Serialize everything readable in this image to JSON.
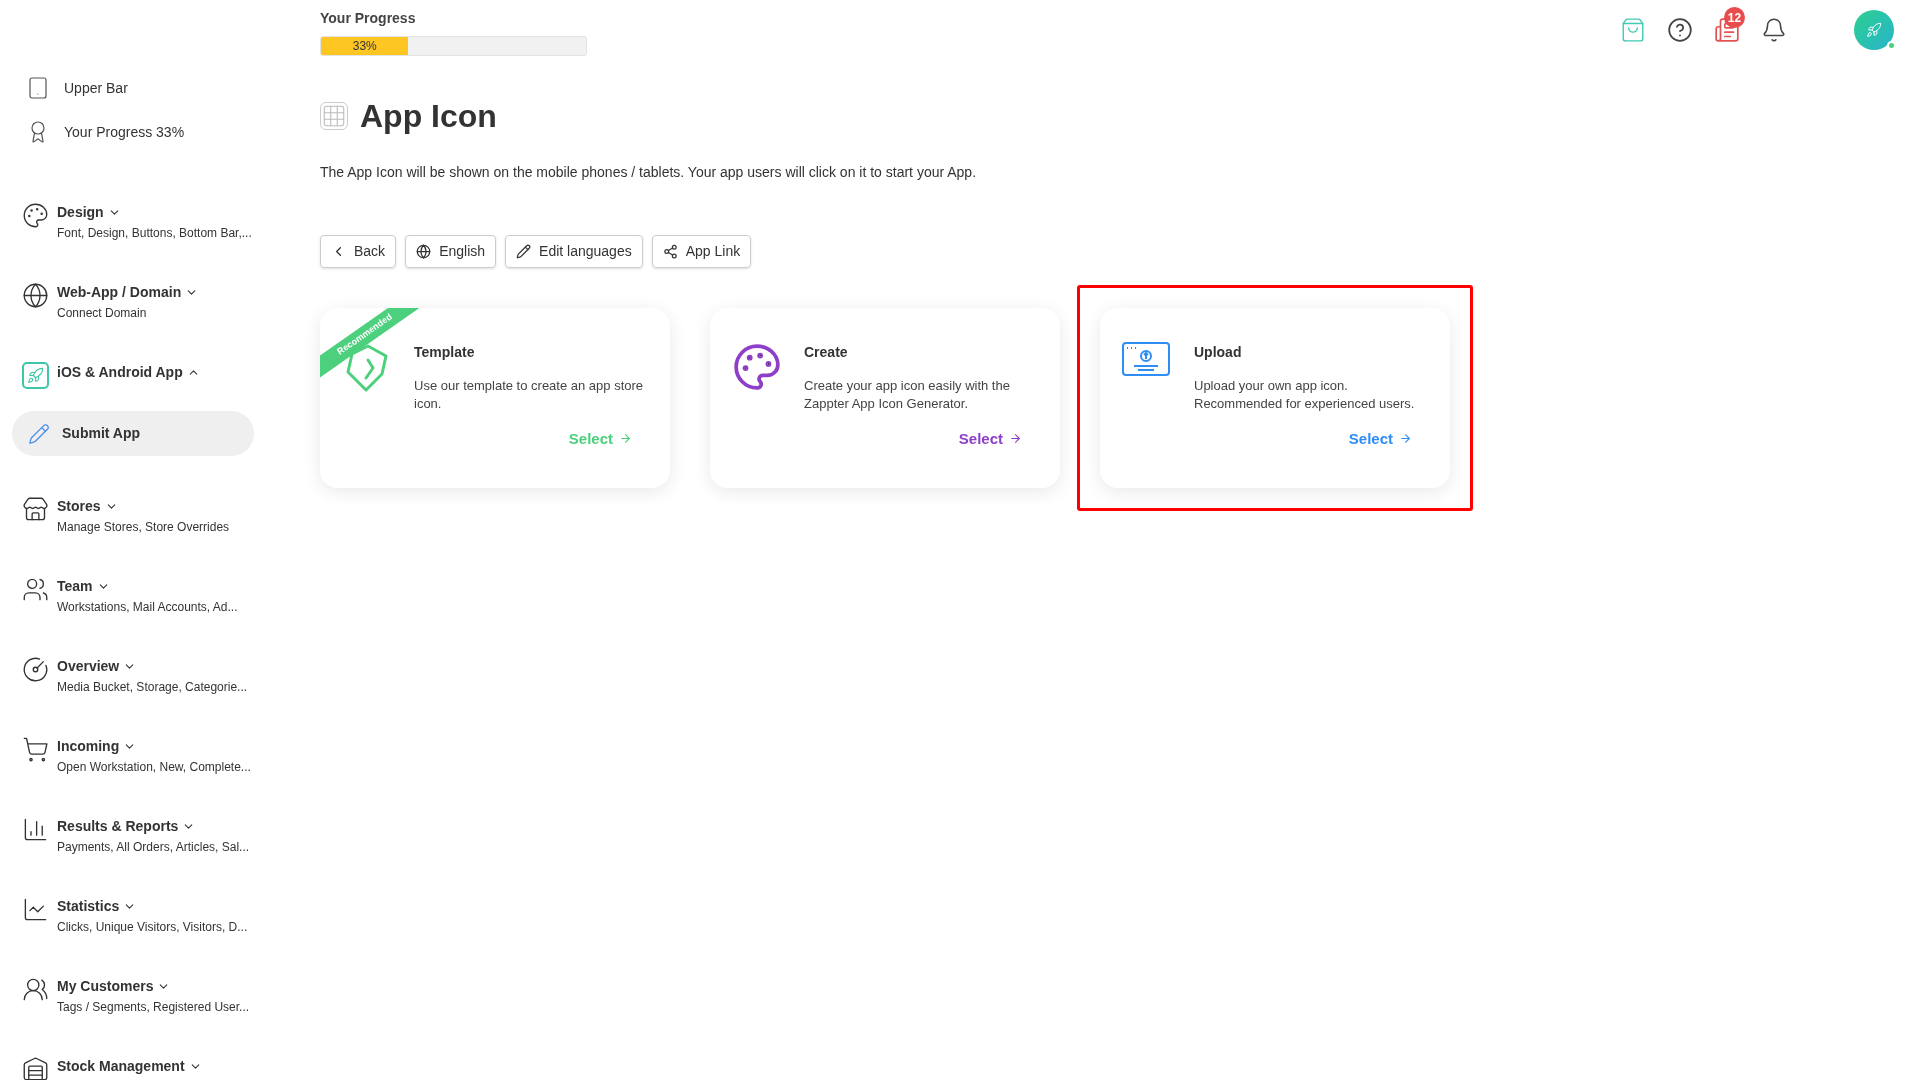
{
  "sidebar": {
    "items": [
      {
        "kind": "link",
        "label": "Upper Bar"
      },
      {
        "kind": "link",
        "label": "Your Progress 33%"
      },
      {
        "kind": "section",
        "label": "Design",
        "subtitle": "Font, Design, Buttons, Bottom Bar,...",
        "expanded": false
      },
      {
        "kind": "section",
        "label": "Web-App / Domain",
        "subtitle": "Connect Domain",
        "expanded": false
      },
      {
        "kind": "section",
        "label": "iOS & Android App",
        "expanded": true,
        "children": [
          {
            "label": "Submit App",
            "selected": true
          }
        ]
      },
      {
        "kind": "section",
        "label": "Stores",
        "subtitle": "Manage Stores, Store Overrides",
        "expanded": false
      },
      {
        "kind": "section",
        "label": "Team",
        "subtitle": "Workstations, Mail Accounts, Ad...",
        "expanded": false
      },
      {
        "kind": "section",
        "label": "Overview",
        "subtitle": "Media Bucket, Storage, Categorie...",
        "expanded": false
      },
      {
        "kind": "section",
        "label": "Incoming",
        "subtitle": "Open Workstation, New, Complete...",
        "expanded": false
      },
      {
        "kind": "section",
        "label": "Results & Reports",
        "subtitle": "Payments, All Orders, Articles, Sal...",
        "expanded": false
      },
      {
        "kind": "section",
        "label": "Statistics",
        "subtitle": "Clicks, Unique Visitors, Visitors, D...",
        "expanded": false
      },
      {
        "kind": "section",
        "label": "My Customers",
        "subtitle": "Tags / Segments, Registered User...",
        "expanded": false
      },
      {
        "kind": "section",
        "label": "Stock Management",
        "expanded": false
      }
    ]
  },
  "progress": {
    "label": "Your Progress",
    "level": 0.33,
    "reading": "33%"
  },
  "header": {
    "notification_badge": "12"
  },
  "page": {
    "title": "App Icon",
    "description": "The App Icon will be shown on the mobile phones / tablets. Your app users will click on it to start your App."
  },
  "toolbar": [
    "Back",
    "English",
    "Edit languages",
    "App Link"
  ],
  "cards": [
    {
      "title": "Template",
      "description": "Use our template to create an app store icon.",
      "action": "Select",
      "ribbon": "Recommended",
      "color": "#4cd07d",
      "highlighted": false
    },
    {
      "title": "Create",
      "description": "Create your app icon easily with the Zappter App Icon Generator.",
      "action": "Select",
      "color": "#8e3fc9",
      "highlighted": false
    },
    {
      "title": "Upload",
      "description": "Upload your own app icon. Recommended for experienced users.",
      "action": "Select",
      "color": "#2f8ef4",
      "highlighted": true
    }
  ]
}
